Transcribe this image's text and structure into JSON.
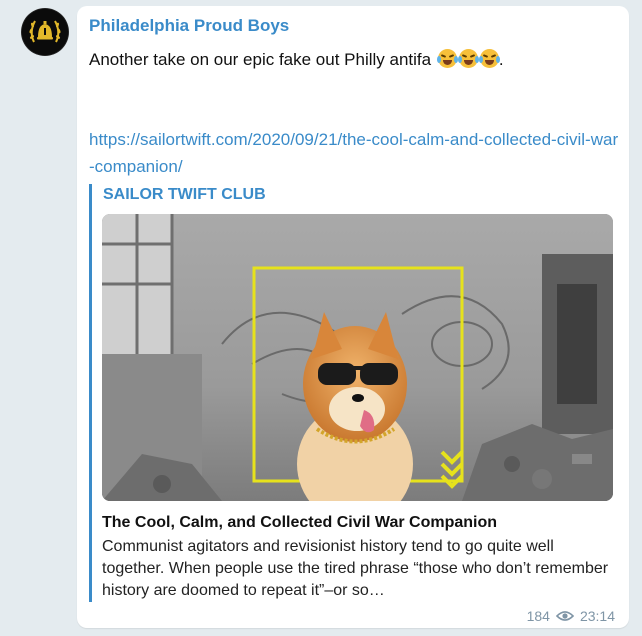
{
  "channel": {
    "name": "Philadelphia Proud Boys",
    "avatar_icon": "laurel-bell-logo-icon"
  },
  "message": {
    "text": "Another take on our epic fake out Philly antifa",
    "trailing": ".",
    "emoji": [
      "face-with-tears-of-joy",
      "face-with-tears-of-joy",
      "face-with-tears-of-joy"
    ],
    "link": "https://sailortwift.com/2020/09/21/the-cool-calm-and-collected-civil-war-companion/"
  },
  "link_preview": {
    "site_name": "SAILOR TWIFT CLUB",
    "image_icon": "shiba-sunglasses-image",
    "title": "The Cool, Calm, and Collected Civil War Companion",
    "description": "Communist agitators and revisionist history tend to go quite well together. When people use the tired phrase “those who don’t remember history are doomed to repeat it”–or so…"
  },
  "footer": {
    "views": "184",
    "views_icon": "eye-icon",
    "time": "23:14"
  },
  "colors": {
    "accent": "#3a8bc9",
    "background": "#e4ebef",
    "frame_yellow": "#e6e21c"
  }
}
